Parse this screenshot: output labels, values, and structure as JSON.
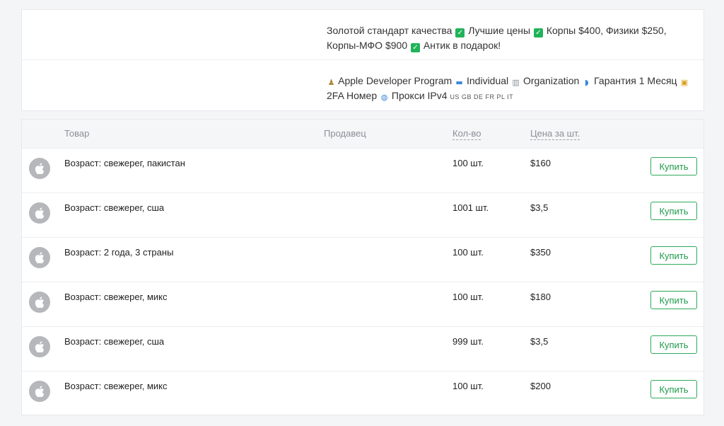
{
  "promo": {
    "line1": {
      "t1": "Золотой стандарт качества",
      "t2": "Лучшие цены",
      "t3": "Корпы $400, Физики $250, Корпы-МФО $900",
      "t4": "Антик в подарок!"
    },
    "line2": {
      "t1": "Apple Developer Program",
      "t2": "Individual",
      "t3": "Organization",
      "t4": "Гарантия 1 Месяц",
      "t5": "2FA Номер",
      "t6": "Прокси IPv4",
      "flags": "US GB DE FR PL IT"
    }
  },
  "table": {
    "headers": {
      "product": "Товар",
      "seller": "Продавец",
      "qty": "Кол-во",
      "price": "Цена за шт."
    },
    "buy_label": "Купить",
    "rows": [
      {
        "name": "Возраст: свежерег, пакистан",
        "qty": "100 шт.",
        "price": "$160"
      },
      {
        "name": "Возраст: свежерег, сша",
        "qty": "1001 шт.",
        "price": "$3,5"
      },
      {
        "name": "Возраст: 2 года, 3 страны",
        "qty": "100 шт.",
        "price": "$350"
      },
      {
        "name": "Возраст: свежерег, микс",
        "qty": "100 шт.",
        "price": "$180"
      },
      {
        "name": "Возраст: свежерег, сша",
        "qty": "999 шт.",
        "price": "$3,5"
      },
      {
        "name": "Возраст: свежерег, микс",
        "qty": "100 шт.",
        "price": "$200"
      }
    ]
  },
  "colors": {
    "accent": "#21b35a",
    "buy_border": "#2faa5a",
    "icon_bg": "#b5b7ba"
  },
  "icons": {
    "check": "check-icon",
    "product": "apple-icon"
  }
}
